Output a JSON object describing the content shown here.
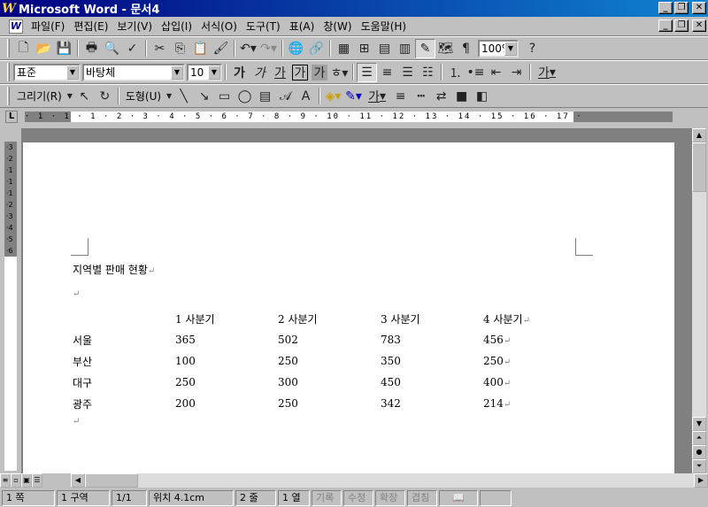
{
  "window": {
    "title": "Microsoft Word - 문서4",
    "app_icon": "W"
  },
  "menu": [
    "파일(F)",
    "편집(E)",
    "보기(V)",
    "삽입(I)",
    "서식(O)",
    "도구(T)",
    "표(A)",
    "창(W)",
    "도움말(H)"
  ],
  "standard_toolbar": {
    "zoom": "100%"
  },
  "formatting_toolbar": {
    "style": "표준",
    "font": "바탕체",
    "size": "10",
    "bold": "가",
    "italic": "가",
    "underline": "가",
    "border_char": "가",
    "shade_char": "가",
    "phonetic": "가",
    "font_color_char": "가"
  },
  "drawing_toolbar": {
    "draw_label": "그리기(R)",
    "autoshapes_label": "도형(U)",
    "font_color_char": "가"
  },
  "ruler": {
    "marks": "· 1 · 1 · 1 · 2 · 3 · 4 · 5 · 6 · 7 · 8 · 9 · 10 · 11 · 12 · 13 · 14 · 15 · 16 · 17 ·"
  },
  "vertical_ruler": {
    "marks": "·3·2·1·1·1·2·3·4·5·6"
  },
  "document": {
    "title": "지역별 판매 현황",
    "paragraph_mark": "↵",
    "headers": [
      "",
      "1 사분기",
      "2 사분기",
      "3 사분기",
      "4 사분기"
    ],
    "rows": [
      [
        "서울",
        "365",
        "502",
        "783",
        "456"
      ],
      [
        "부산",
        "100",
        "250",
        "350",
        "250"
      ],
      [
        "대구",
        "250",
        "300",
        "450",
        "400"
      ],
      [
        "광주",
        "200",
        "250",
        "342",
        "214"
      ]
    ]
  },
  "status": {
    "page": "1 쪽",
    "section": "1 구역",
    "page_of": "1/1",
    "position": "위치 4.1cm",
    "line": "2 줄",
    "column": "1 열",
    "rec": "기록",
    "trk": "수정",
    "ext": "확장",
    "ovr": "겹침"
  },
  "colors": {
    "titlebar_start": "#000080",
    "titlebar_end": "#1084d0",
    "chrome": "#c0c0c0"
  }
}
